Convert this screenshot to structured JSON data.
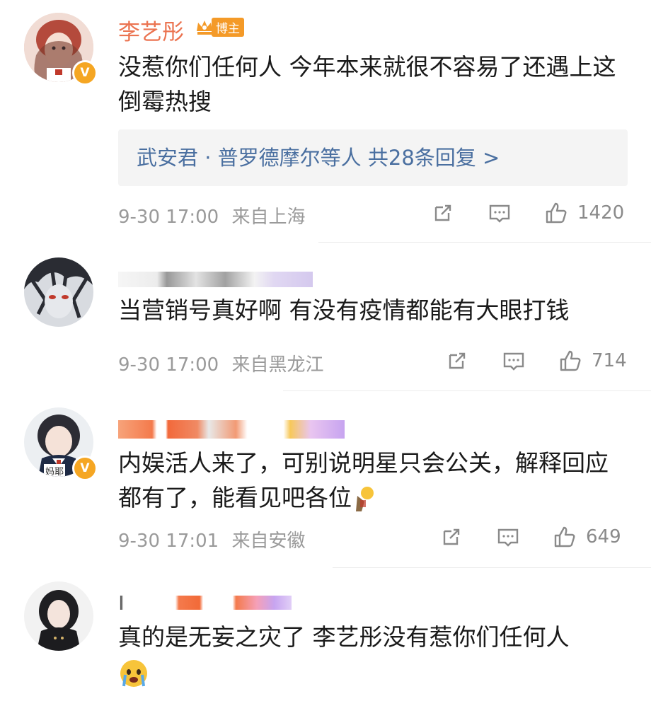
{
  "comments": [
    {
      "name": "李艺彤",
      "badge": "博主",
      "text": "没惹你们任何人 今年本来就很不容易了还遇上这倒霉热搜",
      "replies": "武安君 · 普罗德摩尔等人  共28条回复 >",
      "time": "9-30 17:00",
      "location": "来自上海",
      "likes": "1420"
    },
    {
      "text": "当营销号真好啊 有没有疫情都能有大眼打钱",
      "time": "9-30 17:00",
      "location": "来自黑龙江",
      "likes": "714"
    },
    {
      "text": "内娱活人来了，可别说明星只会公关，解释回应都有了，能看见吧各位",
      "time": "9-30 17:01",
      "location": "来自安徽",
      "likes": "649",
      "avatar_caption": "妈耶"
    },
    {
      "text": "真的是无妄之灾了 李艺彤没有惹你们任何人"
    }
  ],
  "icons": {
    "share": "share-icon",
    "comment": "comment-icon",
    "like": "thumbs-up-icon",
    "vip": "verified-v-icon",
    "crown": "crown-icon",
    "emoji_cry": "crying-face-emoji",
    "emoji_thinking": "thinking-face-emoji"
  },
  "colors": {
    "name": "#eb7350",
    "replies": "#4a6fa0",
    "meta": "#9a9a9a",
    "badge": "#f49a28"
  }
}
